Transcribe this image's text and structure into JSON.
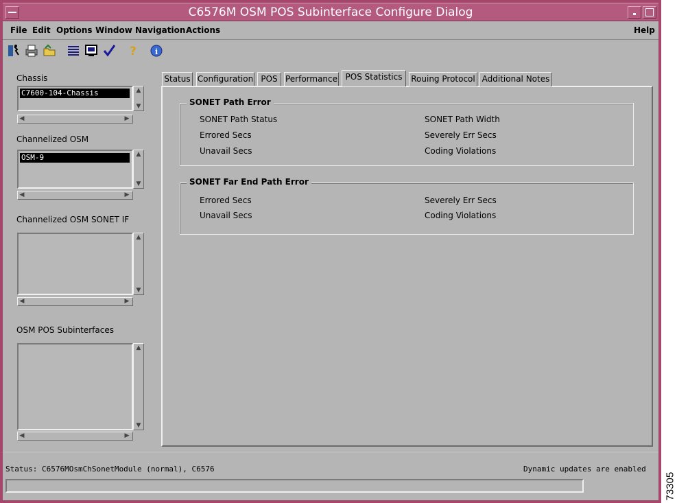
{
  "window": {
    "title": "C6576M OSM POS Subinterface Configure Dialog"
  },
  "menubar": {
    "items": [
      "File",
      "Edit",
      "Options",
      "Window",
      "Navigation",
      "Actions"
    ],
    "help": "Help"
  },
  "toolbar": {
    "icons": [
      "exit-icon",
      "print-icon",
      "open-folder-icon",
      "list-icon",
      "monitor-icon",
      "check-icon",
      "help-icon",
      "info-icon"
    ]
  },
  "left": {
    "chassis_label": "Chassis",
    "chassis_selected": "C7600-104-Chassis",
    "osm_label": "Channelized OSM",
    "osm_selected": "OSM-9",
    "sonet_if_label": "Channelized OSM SONET IF",
    "subif_label": "OSM POS Subinterfaces"
  },
  "tabs": [
    "Status",
    "Configuration",
    "POS",
    "Performance",
    "POS Statistics",
    "Rouing Protocol",
    "Additional Notes"
  ],
  "active_tab": "POS Statistics",
  "path_error": {
    "title": "SONET Path Error",
    "left": [
      "SONET Path Status",
      "Errored Secs",
      "Unavail Secs"
    ],
    "right": [
      "SONET Path Width",
      "Severely Err Secs",
      "Coding Violations"
    ]
  },
  "far_end_error": {
    "title": "SONET Far End Path Error",
    "left": [
      "Errored Secs",
      "Unavail Secs"
    ],
    "right": [
      "Severely Err Secs",
      "Coding Violations"
    ]
  },
  "statusbar": {
    "status": "Status: C6576MOsmChSonetModule (normal), C6576",
    "updates": "Dynamic updates are enabled"
  },
  "figure_number": "73305",
  "colors": {
    "frame": "#a5476a",
    "panel": "#b5b5b5"
  }
}
